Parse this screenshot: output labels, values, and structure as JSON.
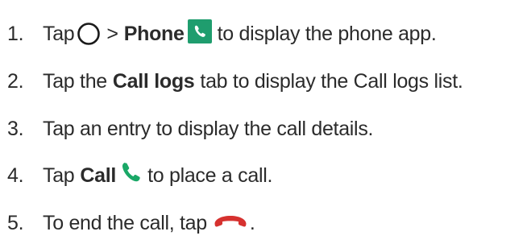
{
  "steps": [
    {
      "number": "1.",
      "parts": {
        "a": "Tap",
        "b": ">",
        "c": "Phone",
        "d": "to display the phone app."
      },
      "icons": [
        "home-circle-icon",
        "phone-app-icon"
      ]
    },
    {
      "number": "2.",
      "parts": {
        "a": "Tap the",
        "b": "Call logs",
        "c": "tab to display the Call logs list."
      }
    },
    {
      "number": "3.",
      "parts": {
        "a": "Tap an entry to display the call details."
      }
    },
    {
      "number": "4.",
      "parts": {
        "a": "Tap",
        "b": "Call",
        "c": "to place a call."
      },
      "icons": [
        "call-icon"
      ]
    },
    {
      "number": "5.",
      "parts": {
        "a": "To end the call, tap",
        "b": "."
      },
      "icons": [
        "end-call-icon"
      ]
    }
  ],
  "colors": {
    "text": "#2b2b2b",
    "phone_app_green": "#1f9d6e",
    "call_green": "#1aa867",
    "end_call_red": "#d6312f"
  }
}
